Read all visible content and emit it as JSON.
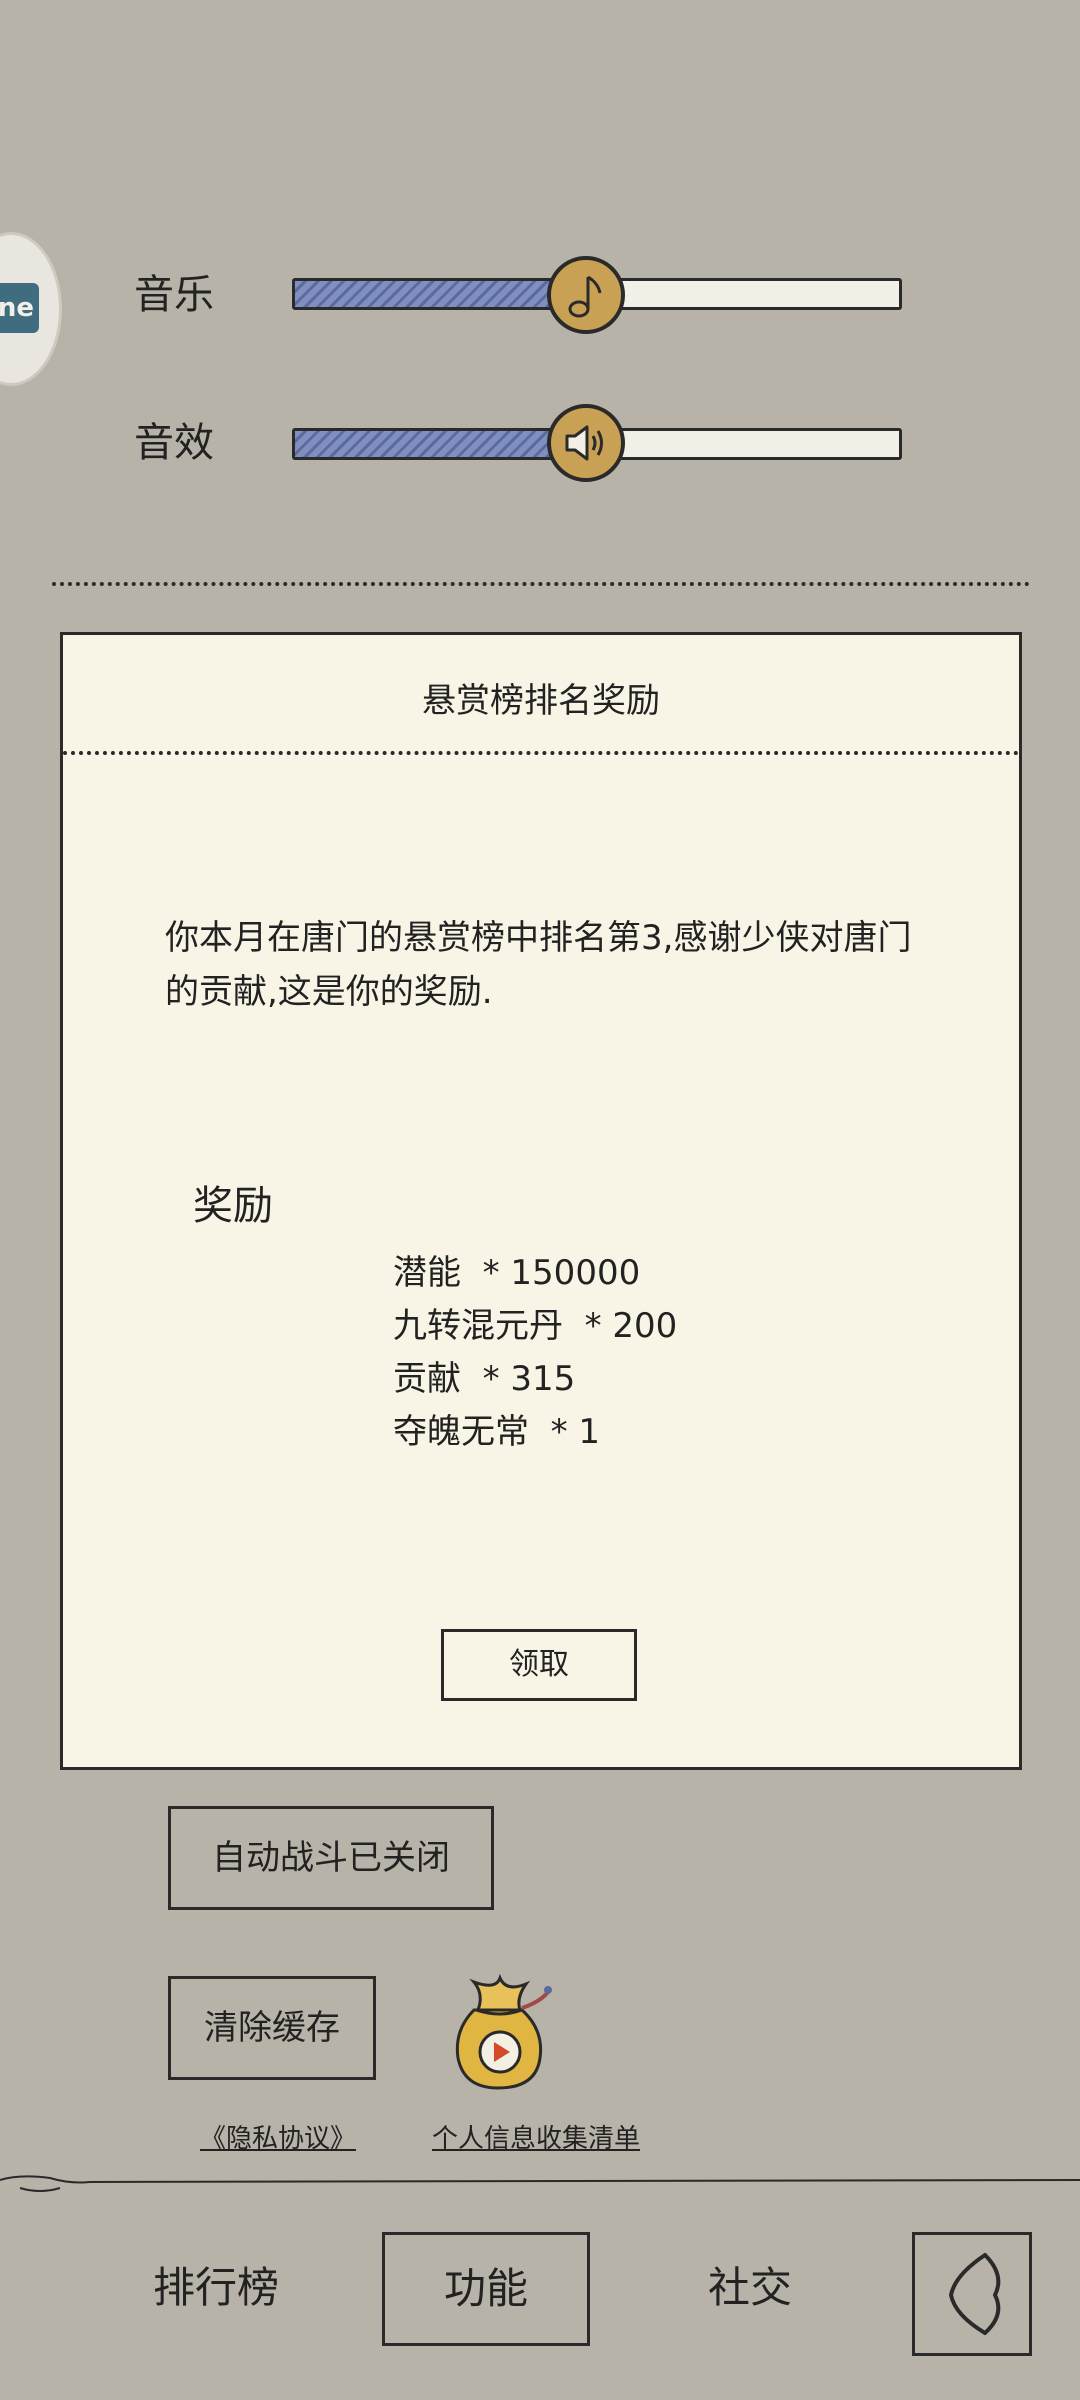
{
  "settings": {
    "music_label": "音乐",
    "music_level": 0.44,
    "sfx_label": "音效",
    "sfx_level": 0.44,
    "music_knob_icon": "music-note-icon",
    "sfx_knob_icon": "speaker-icon"
  },
  "panel": {
    "title": "悬赏榜排名奖励",
    "message": "你本月在唐门的悬赏榜中排名第3,感谢少侠对唐门的贡献,这是你的奖励.",
    "reward_heading": "奖励",
    "rewards": [
      "潜能  * 150000",
      "九转混元丹  * 200",
      "贡献  * 315",
      "夺魄无常  * 1"
    ],
    "claim_label": "领取"
  },
  "auto_battle_label": "自动战斗已关闭",
  "clear_cache_label": "清除缓存",
  "links": {
    "privacy": "《隐私协议》",
    "personal_info": "个人信息收集清单"
  },
  "bottom_nav": {
    "items": [
      "排行榜",
      "功能",
      "社交"
    ],
    "active": "功能"
  },
  "colors": {
    "background": "#b8b3a8",
    "panel": "#f9f5e6",
    "slider_fill": "#7f8fbe",
    "knob": "#c9a154"
  }
}
